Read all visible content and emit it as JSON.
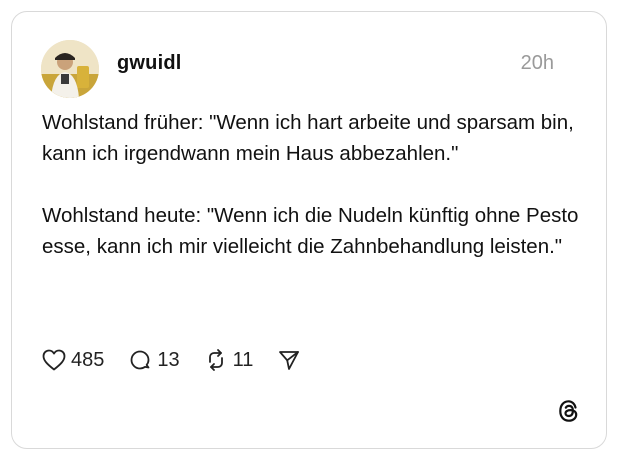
{
  "post": {
    "username": "gwuidl",
    "timestamp": "20h",
    "paragraphs": [
      "Wohlstand früher: \"Wenn ich hart arbeite und sparsam bin, kann ich irgendwann mein Haus abbezahlen.\"",
      "Wohlstand heute: \"Wenn ich die Nudeln künftig ohne Pesto esse, kann ich mir vielleicht die Zahnbehandlung leisten.\""
    ]
  },
  "actions": {
    "likes": "485",
    "replies": "13",
    "reposts": "11"
  },
  "icons": {
    "like": "heart-icon",
    "reply": "speech-bubble-icon",
    "repost": "repost-arrows-icon",
    "share": "paper-plane-icon",
    "brand": "threads-logo-icon"
  },
  "colors": {
    "text": "#111111",
    "muted": "#9a9a9a",
    "border": "#d9d9d9"
  }
}
